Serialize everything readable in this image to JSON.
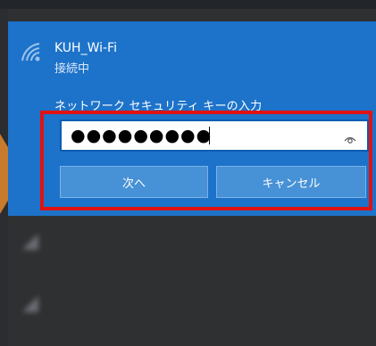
{
  "network": {
    "ssid": "KUH_Wi-Fi",
    "status": "接続中",
    "key_label": "ネットワーク セキュリティ キーの入力",
    "password_mask": "●●●●●●●●●",
    "next_label": "次へ",
    "cancel_label": "キャンセル"
  },
  "other_networks": [
    {
      "name": "",
      "status": ""
    },
    {
      "name": "",
      "status": ""
    }
  ],
  "colors": {
    "panel": "#1d73c9",
    "button": "#4791d6",
    "highlight": "#e01212",
    "background": "#2f3032"
  },
  "icons": {
    "wifi": "wifi-signal-icon",
    "reveal": "eye-icon",
    "other_network": "wifi-locked-icon"
  }
}
